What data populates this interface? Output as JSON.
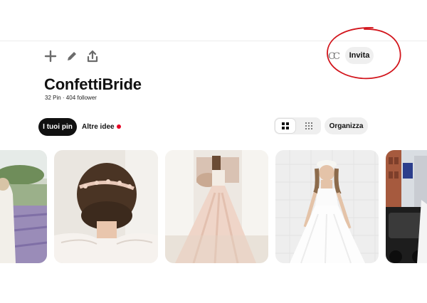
{
  "board": {
    "title": "ConfettiBride",
    "stats": "32 Pin · 404 follower"
  },
  "toolbar": {
    "icons": [
      "plus-icon",
      "pencil-icon",
      "share-icon"
    ]
  },
  "avatar": {
    "initials": "CC"
  },
  "invite": {
    "label": "Invita"
  },
  "tabs": {
    "pins_label": "I tuoi pin",
    "ideas_label": "Altre idee"
  },
  "view_toggle": {
    "icons": [
      "grid-large-icon",
      "grid-small-icon"
    ],
    "selected": "grid-large"
  },
  "organize": {
    "label": "Organizza"
  },
  "pins": [
    "lavender-field-bride-photo",
    "bridal-hair-comb-photo",
    "blush-tulle-gown-photo",
    "white-gown-bride-photo",
    "city-street-bride-photo"
  ],
  "colors": {
    "tab_active_bg": "#111111",
    "pill_bg": "#efefef",
    "notification_dot": "#e60023",
    "annotation_circle": "#d2141b"
  }
}
